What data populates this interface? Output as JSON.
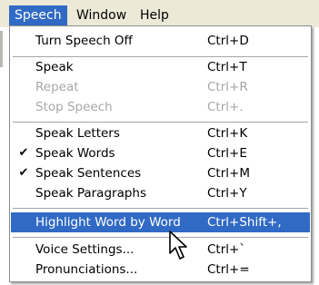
{
  "menubar": {
    "items": [
      {
        "label": "Speech",
        "active": true
      },
      {
        "label": "Window",
        "active": false
      },
      {
        "label": "Help",
        "active": false
      }
    ]
  },
  "menu": {
    "items": [
      {
        "label": "Turn Speech Off",
        "shortcut": "Ctrl+D",
        "checked": false,
        "enabled": true
      },
      {
        "label": "Speak",
        "shortcut": "Ctrl+T",
        "checked": false,
        "enabled": true
      },
      {
        "label": "Repeat",
        "shortcut": "Ctrl+R",
        "checked": false,
        "enabled": false
      },
      {
        "label": "Stop Speech",
        "shortcut": "Ctrl+.",
        "checked": false,
        "enabled": false
      },
      {
        "label": "Speak Letters",
        "shortcut": "Ctrl+K",
        "checked": false,
        "enabled": true
      },
      {
        "label": "Speak Words",
        "shortcut": "Ctrl+E",
        "checked": true,
        "enabled": true
      },
      {
        "label": "Speak Sentences",
        "shortcut": "Ctrl+M",
        "checked": true,
        "enabled": true
      },
      {
        "label": "Speak Paragraphs",
        "shortcut": "Ctrl+Y",
        "checked": false,
        "enabled": true
      },
      {
        "label": "Highlight Word by Word",
        "shortcut": "Ctrl+Shift+,",
        "checked": false,
        "enabled": true,
        "highlighted": true
      },
      {
        "label": "Voice Settings...",
        "shortcut": "Ctrl+`",
        "checked": false,
        "enabled": true
      },
      {
        "label": "Pronunciations...",
        "shortcut": "Ctrl+=",
        "checked": false,
        "enabled": true
      }
    ],
    "check_glyph": "✔"
  },
  "colors": {
    "menubar_bg": "#ece9d8",
    "highlight_bg": "#316ac5",
    "disabled_text": "#a7a7a7"
  },
  "icons": {
    "cursor": "arrow-pointer-icon"
  }
}
